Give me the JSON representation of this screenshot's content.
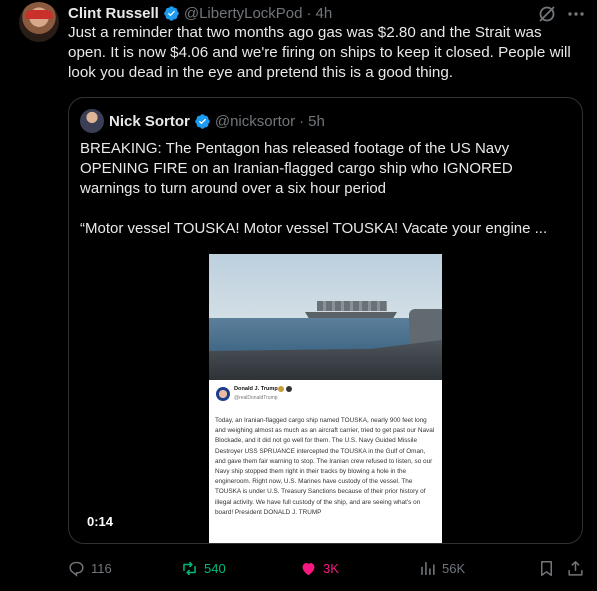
{
  "tweet": {
    "author_name": "Clint Russell",
    "author_handle": "@LibertyLockPod",
    "separator": "·",
    "time": "4h",
    "text": "Just a reminder that two months ago gas was $2.80 and the Strait was open. It is now $4.06 and we're firing on ships to keep it closed. People will look you dead in the eye and pretend this is a good thing."
  },
  "quote": {
    "author_name": "Nick Sortor",
    "author_handle": "@nicksortor",
    "separator": "·",
    "time": "5h",
    "paragraph1": "BREAKING: The Pentagon has released footage of the US Navy OPENING FIRE on an Iranian-flagged cargo ship who IGNORED warnings to turn around over a six hour period",
    "paragraph2": "“Motor vessel TOUSKA! Motor vessel TOUSKA! Vacate your engine ...",
    "video": {
      "duration": "0:14",
      "post_name": "Donald J. Trump",
      "post_handle": "@realDonaldTrump",
      "post_body": "Today, an Iranian-flagged cargo ship named TOUSKA, nearly 900 feet long and weighing almost as much as an aircraft carrier, tried to get past our Naval Blockade, and it did not go well for them. The U.S. Navy Guided Missile Destroyer USS SPRUANCE intercepted the TOUSKA in the Gulf of Oman, and gave them fair warning to stop. The Iranian crew refused to listen, so our Navy ship stopped them right in their tracks by blowing a hole in the engineroom. Right now, U.S. Marines have custody of the vessel. The TOUSKA is under U.S. Treasury Sanctions because of their prior history of illegal activity. We have full custody of the ship, and are seeing what's on board! President DONALD J. TRUMP"
    }
  },
  "actions": {
    "replies": "116",
    "reposts": "540",
    "likes": "3K",
    "views": "56K"
  },
  "colors": {
    "background": "#000000",
    "text": "#e7e9ea",
    "muted": "#71767b",
    "verified": "#1d9bf0",
    "repost_active": "#00ba7c",
    "like_active": "#f91880",
    "border": "#2f3336"
  }
}
